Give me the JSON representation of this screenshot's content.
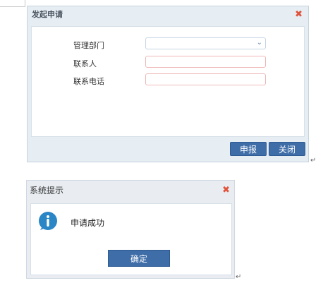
{
  "apply_dialog": {
    "title": "发起申请",
    "close_glyph": "✖",
    "fields": [
      {
        "label": "管理部门",
        "type": "select",
        "value": ""
      },
      {
        "label": "联系人",
        "type": "text",
        "value": ""
      },
      {
        "label": "联系电话",
        "type": "text",
        "value": ""
      }
    ],
    "submit_label": "申报",
    "close_label": "关闭"
  },
  "prompt_dialog": {
    "title": "系统提示",
    "close_glyph": "✖",
    "message": "申请成功",
    "icon": "info-icon",
    "ok_label": "确定"
  },
  "colors": {
    "button": "#3f6da8",
    "close": "#e0533b",
    "info": "#2b86c5"
  }
}
